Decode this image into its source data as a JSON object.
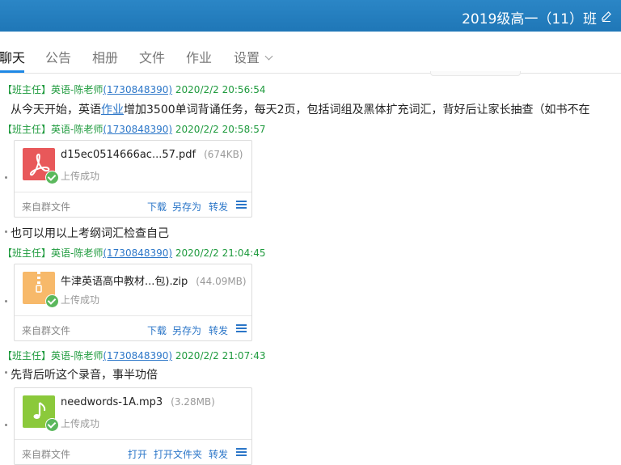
{
  "window": {
    "title": "2019级高一（11）班"
  },
  "tabs": [
    {
      "label": "聊天"
    },
    {
      "label": "公告"
    },
    {
      "label": "相册"
    },
    {
      "label": "文件"
    },
    {
      "label": "作业"
    },
    {
      "label": "设置"
    }
  ],
  "messages": [
    {
      "role": "【班主任】",
      "sender": "英语-陈老师",
      "qq": "(1730848390)",
      "time": "2020/2/2 20:56:54",
      "text_before": "从今天开始，英语",
      "text_link": "作业",
      "text_after": "增加3500单词背诵任务，每天2页，包括词组及黑体扩充词汇，背好后让家长抽查（如书不在"
    },
    {
      "role": "【班主任】",
      "sender": "英语-陈老师",
      "qq": "(1730848390)",
      "time": "2020/2/2 20:58:57",
      "file": {
        "name": "d15ec0514666ac...57.pdf",
        "size": "(674KB)",
        "status": "上传成功",
        "source": "来自群文件",
        "actions": [
          "下载",
          "另存为",
          "转发"
        ],
        "icon": "pdf-icon",
        "color": "#e8585a"
      },
      "text": "也可以用以上考纲词汇检查自己"
    },
    {
      "role": "【班主任】",
      "sender": "英语-陈老师",
      "qq": "(1730848390)",
      "time": "2020/2/2 21:04:45",
      "file": {
        "name": "牛津英语高中教材...包).zip",
        "size": "(44.09MB)",
        "status": "上传成功",
        "source": "来自群文件",
        "actions": [
          "下载",
          "另存为",
          "转发"
        ],
        "icon": "zip-icon",
        "color": "#f7b96a"
      }
    },
    {
      "role": "【班主任】",
      "sender": "英语-陈老师",
      "qq": "(1730848390)",
      "time": "2020/2/2 21:07:43",
      "text": "先背后听这个录音，事半功倍",
      "file": {
        "name": "needwords-1A.mp3",
        "size": "(3.28MB)",
        "status": "上传成功",
        "source": "来自群文件",
        "actions": [
          "打开",
          "打开文件夹",
          "转发"
        ],
        "icon": "music-icon",
        "color": "#8bc93b"
      }
    }
  ]
}
